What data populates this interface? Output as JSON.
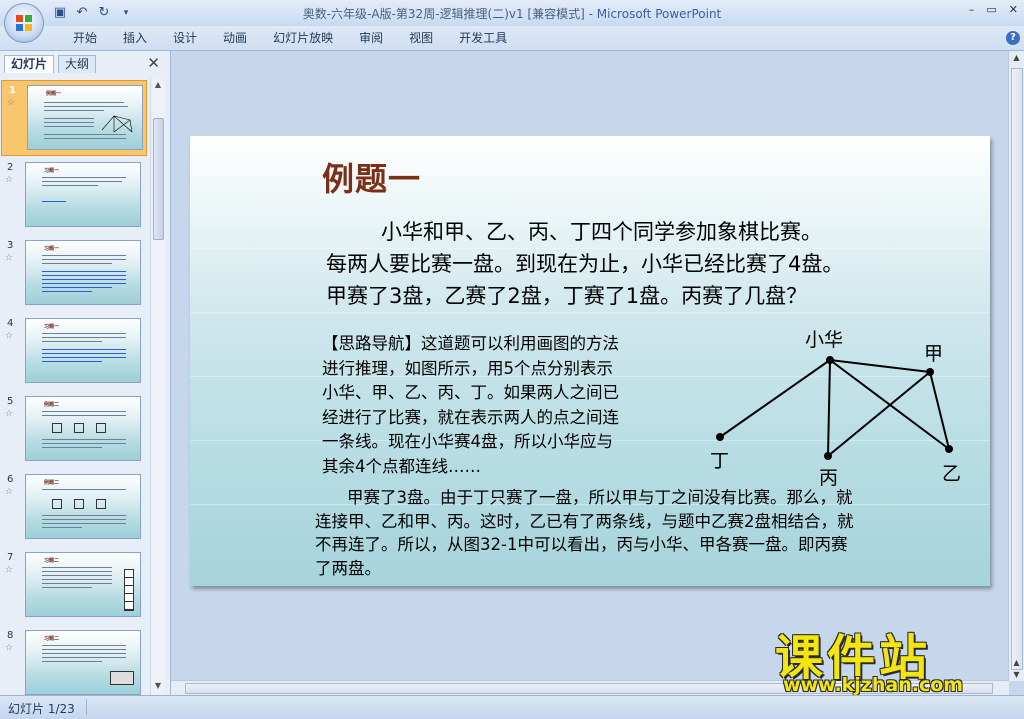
{
  "window": {
    "title": "奥数-六年级-A版-第32周-逻辑推理(二)v1 [兼容模式] - ",
    "app_name": "Microsoft PowerPoint",
    "controls": [
      "–",
      "▭",
      "✕"
    ]
  },
  "ribbon": {
    "tabs": [
      "开始",
      "插入",
      "设计",
      "动画",
      "幻灯片放映",
      "审阅",
      "视图",
      "开发工具"
    ],
    "help": "?"
  },
  "pane": {
    "tabs": [
      "幻灯片",
      "大纲"
    ],
    "close": "✕",
    "thumbnails": [
      {
        "num": "1",
        "title": "例题一"
      },
      {
        "num": "2",
        "title": "习题一"
      },
      {
        "num": "3",
        "title": "习题一"
      },
      {
        "num": "4",
        "title": "习题一"
      },
      {
        "num": "5",
        "title": "例题二"
      },
      {
        "num": "6",
        "title": "例题二"
      },
      {
        "num": "7",
        "title": "习题二"
      },
      {
        "num": "8",
        "title": "习题二"
      }
    ]
  },
  "slide": {
    "title": "例题一",
    "problem": [
      "小华和甲、乙、丙、丁四个同学参加象棋比赛。",
      "每两人要比赛一盘。到现在为止，小华已经比赛了4盘。",
      "甲赛了3盘，乙赛了2盘，丁赛了1盘。丙赛了几盘？"
    ],
    "hint": [
      "【思路导航】这道题可以利用画图的方法",
      "进行推理，如图所示，用5个点分别表示",
      "小华、甲、乙、丙、丁。如果两人之间已",
      "经进行了比赛，就在表示两人的点之间连",
      "一条线。现在小华赛4盘，所以小华应与",
      "其余4个点都连线……"
    ],
    "solution": [
      "甲赛了3盘。由于丁只赛了一盘，所以甲与丁之间没有比赛。那么，就",
      "连接甲、乙和甲、丙。这时，乙已有了两条线，与题中乙赛2盘相结合，就",
      "不再连了。所以，从图32-1中可以看出，丙与小华、甲各赛一盘。即丙赛",
      "了两盘。"
    ],
    "diagram": {
      "labels": {
        "xiaohua": "小华",
        "jia": "甲",
        "yi": "乙",
        "bing": "丙",
        "ding": "丁"
      }
    }
  },
  "watermark": {
    "text": "课件站",
    "url": "www.kjzhan.com"
  },
  "status": {
    "slide_counter": "幻灯片 1/23"
  }
}
